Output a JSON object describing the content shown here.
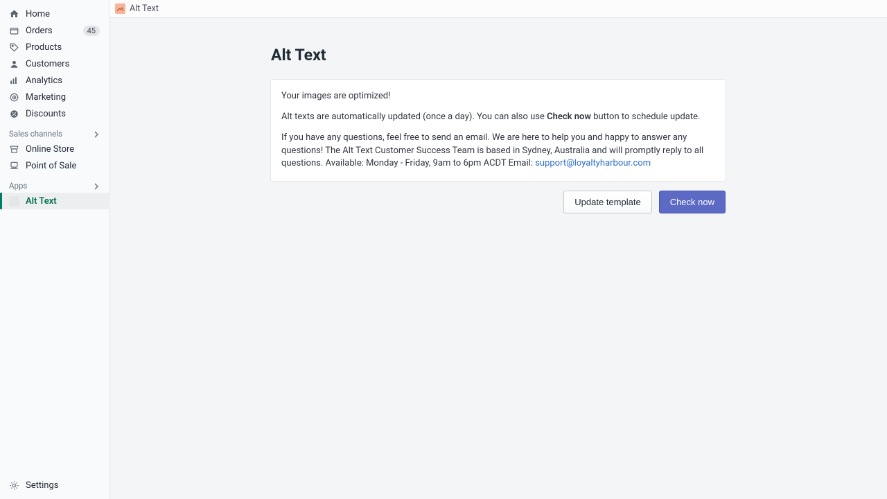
{
  "sidebar": {
    "items": [
      {
        "label": "Home"
      },
      {
        "label": "Orders",
        "badge": "45"
      },
      {
        "label": "Products"
      },
      {
        "label": "Customers"
      },
      {
        "label": "Analytics"
      },
      {
        "label": "Marketing"
      },
      {
        "label": "Discounts"
      }
    ],
    "sales_channels_header": "Sales channels",
    "sales_channels": [
      {
        "label": "Online Store"
      },
      {
        "label": "Point of Sale"
      }
    ],
    "apps_header": "Apps",
    "apps": [
      {
        "label": "Alt Text"
      }
    ],
    "settings_label": "Settings"
  },
  "topbar": {
    "title": "Alt Text"
  },
  "page": {
    "title": "Alt Text",
    "optimized_msg": "Your images are optimized!",
    "auto_msg_pre": "Alt texts are automatically updated (once a day). You can also use ",
    "auto_msg_bold": "Check now",
    "auto_msg_post": " button to schedule update.",
    "support_msg": "If you have any questions, feel free to send an email. We are here to help you and happy to answer any questions! The Alt Text Customer Success Team is based in Sydney, Australia and will promptly reply to all questions. Available: Monday - Friday, 9am to 6pm ACDT Email: ",
    "support_email": "support@loyaltyharbour.com"
  },
  "actions": {
    "update_template": "Update template",
    "check_now": "Check now"
  }
}
